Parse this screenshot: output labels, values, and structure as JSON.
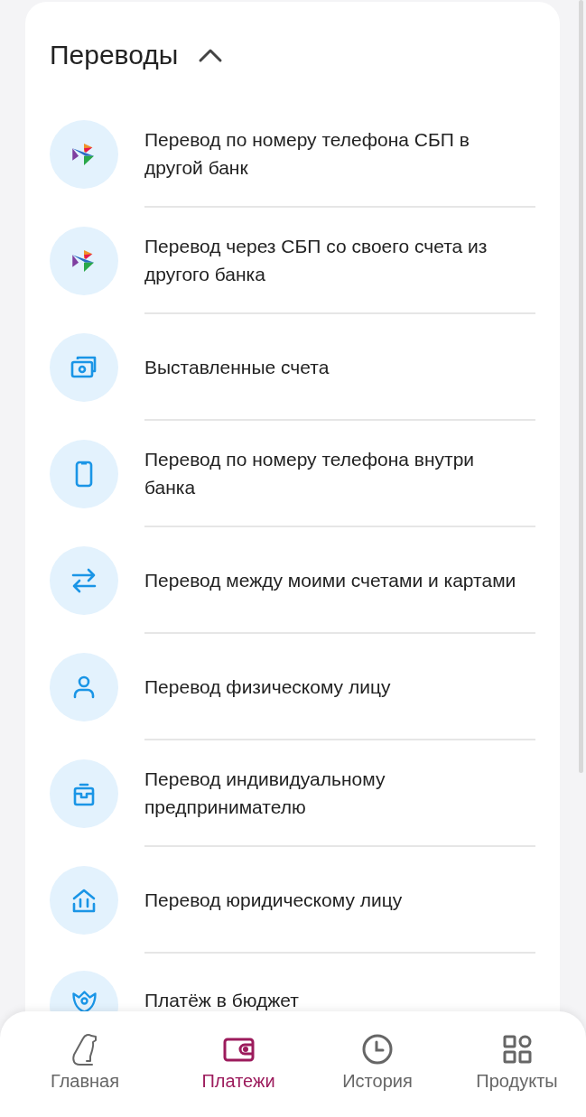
{
  "section": {
    "title": "Переводы",
    "expanded": true
  },
  "items": [
    {
      "kind": "sbp",
      "label": "Перевод по номеру телефона СБП в другой банк"
    },
    {
      "kind": "sbp",
      "label": "Перевод через СБП со своего счета из другого банка"
    },
    {
      "kind": "invoice",
      "label": "Выставленные счета"
    },
    {
      "kind": "phone",
      "label": "Перевод по номеру телефона внутри банка"
    },
    {
      "kind": "arrows",
      "label": "Перевод между моими счетами и картами"
    },
    {
      "kind": "person",
      "label": "Перевод физическому лицу"
    },
    {
      "kind": "briefcase",
      "label": "Перевод индивидуальному предпринимателю"
    },
    {
      "kind": "bank",
      "label": "Перевод юридическому лицу"
    },
    {
      "kind": "emblem",
      "label": "Платёж в бюджет"
    }
  ],
  "nav": [
    {
      "kind": "home",
      "label": "Главная",
      "selected": false
    },
    {
      "kind": "wallet",
      "label": "Платежи",
      "selected": true
    },
    {
      "kind": "history",
      "label": "История",
      "selected": false
    },
    {
      "kind": "products",
      "label": "Продукты",
      "selected": false
    }
  ]
}
